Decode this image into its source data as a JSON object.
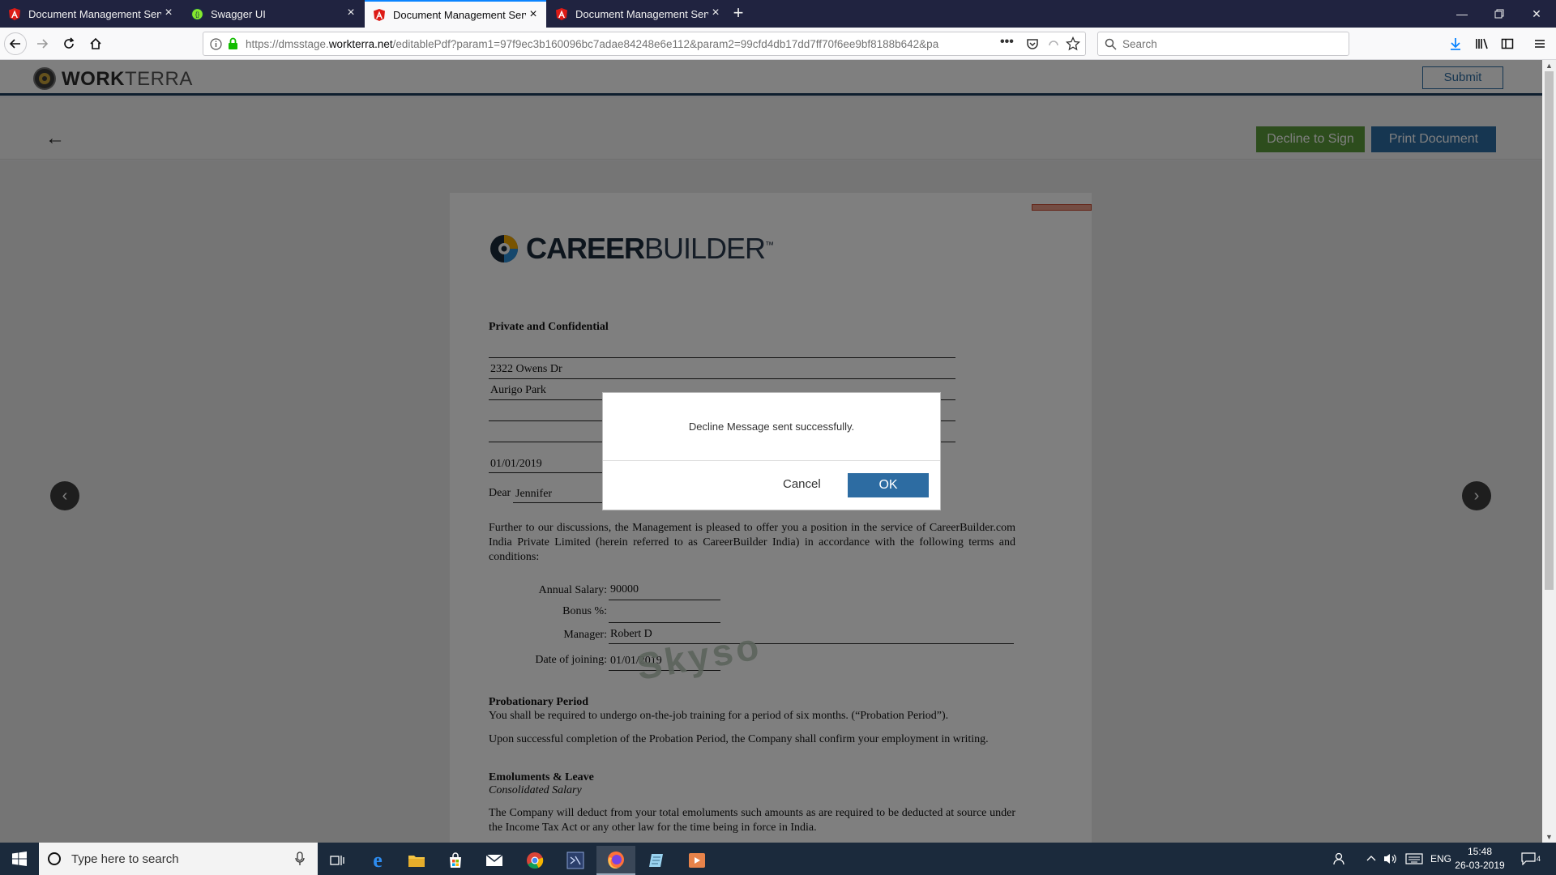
{
  "browser": {
    "tabs": [
      {
        "title": "Document Management Servic",
        "icon": "angular-icon"
      },
      {
        "title": "Swagger UI",
        "icon": "swagger-icon"
      },
      {
        "title": "Document Management Servic",
        "icon": "angular-icon"
      },
      {
        "title": "Document Management Servic",
        "icon": "angular-icon"
      }
    ],
    "active_tab": 2,
    "url_prefix": "https://dmsstage.",
    "url_domain": "workterra.net",
    "url_path": "/editablePdf?param1=97f9ec3b160096bc7adae84248e6e112&param2=99cfd4db17dd7ff70f6ee9bf8188b642&pa",
    "search_placeholder": "Search"
  },
  "app": {
    "logo_bold": "WORK",
    "logo_light": "TERRA",
    "submit_label": "Submit",
    "decline_label": "Decline to Sign",
    "print_label": "Print Document"
  },
  "document": {
    "logo_bold": "CAREER",
    "logo_light": "BUILDER",
    "logo_tm": "™",
    "heading": "Private and Confidential",
    "address_line1": "2322 Owens Dr",
    "address_line2": "Aurigo Park",
    "date": "01/01/2019",
    "dear_label": "Dear",
    "dear_name": "Jennifer",
    "intro": "Further to our discussions, the Management is pleased to offer you a position in the service of CareerBuilder.com India Private Limited (herein referred to as CareerBuilder India) in accordance with the following terms and conditions:",
    "fields": [
      {
        "label": "Annual Salary:",
        "value": "90000"
      },
      {
        "label": "Bonus %:",
        "value": ""
      },
      {
        "label": "Manager:",
        "value": "Robert D"
      },
      {
        "label": "Date of joining:",
        "value": "01/01/2019"
      }
    ],
    "watermark": "Skyso",
    "probation_title": "Probationary Period",
    "probation_text1": "You shall be required to undergo on-the-job training for a period of six months. (“Probation Period”).",
    "probation_text2": "Upon successful completion of the Probation Period, the Company shall confirm your employment in writing.",
    "emoluments_title": "Emoluments & Leave",
    "emoluments_subtitle": "Consolidated Salary",
    "emoluments_text": "The Company will deduct from your total emoluments such amounts as are required to be deducted at source under the Income Tax Act or any other law for the time being in force in India."
  },
  "dialog": {
    "message": "Decline Message sent successfully.",
    "cancel_label": "Cancel",
    "ok_label": "OK"
  },
  "taskbar": {
    "search_placeholder": "Type here to search",
    "language": "ENG",
    "time": "15:48",
    "date": "26-03-2019",
    "notification_count": "4"
  }
}
